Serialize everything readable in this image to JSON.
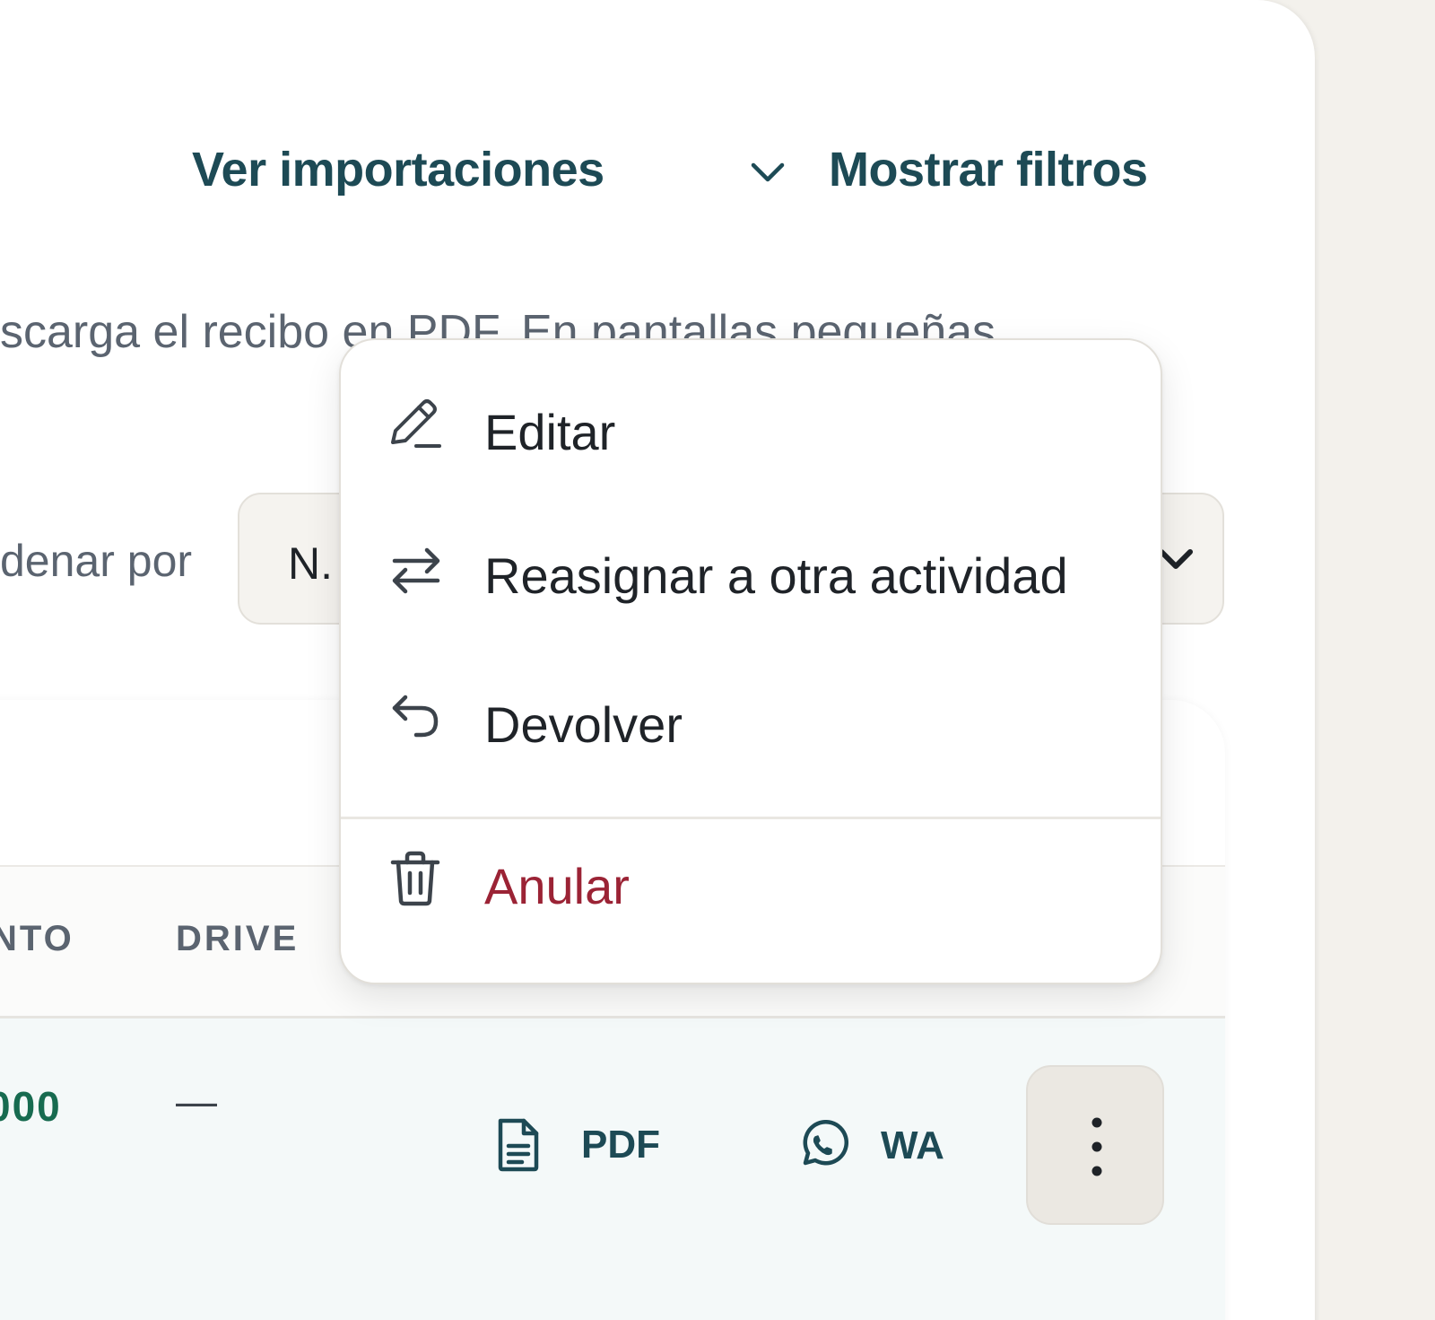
{
  "header": {
    "imports_link": "Ver importaciones",
    "filters_link": "Mostrar filtros"
  },
  "description": "scarga el recibo en PDF. En pantallas pequeñas",
  "sort": {
    "label": "denar por",
    "value": "N."
  },
  "table": {
    "columns": [
      "NTO",
      "DRIVE"
    ],
    "row": {
      "amount": "000",
      "drive": "—",
      "pdf_label": "PDF",
      "wa_label": "WA"
    }
  },
  "menu": {
    "items": [
      {
        "label": "Editar",
        "icon": "pencil-icon"
      },
      {
        "label": "Reasignar a otra actividad",
        "icon": "arrows-swap-icon"
      },
      {
        "label": "Devolver",
        "icon": "undo-arrow-icon"
      },
      {
        "label": "Anular",
        "icon": "trash-icon"
      }
    ]
  },
  "colors": {
    "link": "#1d4a55",
    "amount": "#176b50",
    "danger": "#9b2335",
    "row_highlight": "#f4f9f9"
  }
}
